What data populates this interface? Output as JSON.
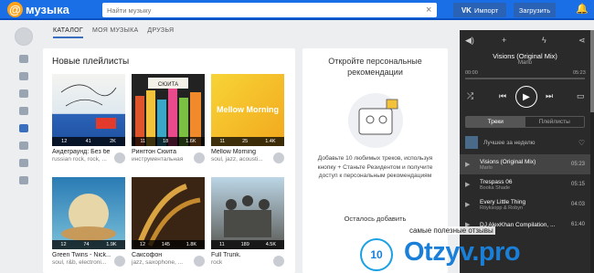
{
  "header": {
    "logo_text": "музыка",
    "logo_at": "@",
    "search_placeholder": "Найти музыку",
    "vk_badge": "VK",
    "import_label": "Импорт",
    "upload_label": "Загрузить"
  },
  "tabs": [
    {
      "label": "КАТАЛОГ",
      "active": true
    },
    {
      "label": "МОЯ МУЗЫКА",
      "active": false
    },
    {
      "label": "ДРУЗЬЯ",
      "active": false
    }
  ],
  "playlists": {
    "title": "Новые плейлисты",
    "items": [
      {
        "name": "Андеграунд: Без бе...",
        "tags": "russian rock, rock, ...",
        "stats": [
          "12",
          "41",
          "2K"
        ]
      },
      {
        "name": "Рингтон Сюита",
        "tags": "инструментальная",
        "stats": [
          "11",
          "18",
          "1.6K"
        ]
      },
      {
        "name": "Mellow Morning",
        "tags": "soul, jazz, acousti...",
        "stats": [
          "11",
          "25",
          "1.4K"
        ]
      },
      {
        "name": "Green Twins - Nick...",
        "tags": "soul, r&b, electroni...",
        "stats": [
          "12",
          "74",
          "1.9K"
        ]
      },
      {
        "name": "Саксофон",
        "tags": "jazz, saxophone, ...",
        "stats": [
          "12",
          "145",
          "1.8K"
        ]
      },
      {
        "name": "Full Trunk.",
        "tags": "rock",
        "stats": [
          "11",
          "189",
          "4.5K"
        ]
      }
    ],
    "cover1_text": "BIG ENEMY",
    "cover2_text": "СЮИТА",
    "cover3_text": "Mellow Morning"
  },
  "recs": {
    "title": "Откройте персональные рекомендации",
    "text": "Добавьте 10 любимых треков, используя кнопку + Станьте Резидентом и получите доступ к персональным рекомендациям",
    "left_label": "Осталось добавить"
  },
  "player": {
    "now_title": "Visions (Original Mix)",
    "now_artist": "Marlo",
    "time_left": "00:00",
    "time_right": "05:23",
    "tab_tracks": "Треки",
    "tab_playlists": "Плейлисты",
    "best_label": "Лучшее за неделю",
    "tracks": [
      {
        "title": "Visions (Original Mix)",
        "artist": "Marlo",
        "dur": "05:23"
      },
      {
        "title": "Trespass 06",
        "artist": "Booka Shade",
        "dur": "05:15"
      },
      {
        "title": "Every Little Thing",
        "artist": "Röyksopp & Robyn",
        "dur": "04:03"
      },
      {
        "title": "DJ AlexKhan Compilation, ...",
        "artist": "",
        "dur": "61:40"
      }
    ]
  },
  "watermark": {
    "badge": "10",
    "name": "Otzyv.pro",
    "sub": "самые полезные отзывы"
  }
}
